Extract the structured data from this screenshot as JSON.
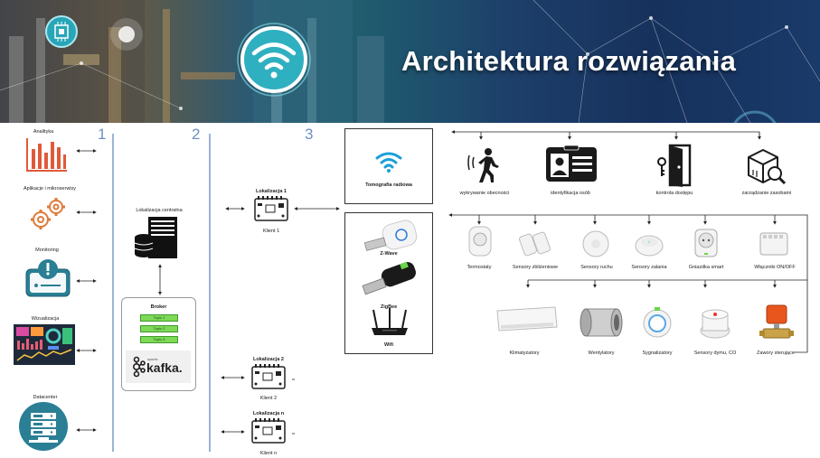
{
  "banner": {
    "title": "Architektura rozwiązania"
  },
  "columns": [
    "1",
    "2",
    "3"
  ],
  "col1": {
    "items": [
      {
        "label": "Analityka",
        "icon": "bar-chart-icon"
      },
      {
        "label": "Aplikacje i mikroserwisy",
        "icon": "gears-icon"
      },
      {
        "label": "Monitoring",
        "icon": "monitoring-alert-icon"
      },
      {
        "label": "Wizualizacja",
        "icon": "dashboard-icon"
      },
      {
        "label": "Datacenter",
        "icon": "datacenter-icon"
      }
    ]
  },
  "col2": {
    "central": {
      "label": "Lokalizacja centralna",
      "icon": "server-icon"
    },
    "broker": {
      "label": "Broker",
      "topics": [
        "Topic 1",
        "Topic 2",
        "Topic 3"
      ],
      "logo_prefix": "apache",
      "logo": "kafka."
    }
  },
  "col3": {
    "locations": [
      {
        "title": "Lokalizacja 1",
        "client": "Klient 1"
      },
      {
        "title": "Lokalizacja 2",
        "client": "Klient 2"
      },
      {
        "title": "Lokalizacja n",
        "client": "Klient n"
      }
    ],
    "tomography": {
      "label": "Tomografia radiowa"
    },
    "radios": [
      {
        "label": "Z-Wave"
      },
      {
        "label": "ZigBee"
      },
      {
        "label": "Wifi"
      }
    ]
  },
  "top_functions": [
    {
      "label": "wykrywanie obecności",
      "icon": "presence-detection-icon"
    },
    {
      "label": "identyfikacja osób",
      "icon": "id-card-icon"
    },
    {
      "label": "kontrola dostępu",
      "icon": "door-access-icon"
    },
    {
      "label": "zarządzanie zasobami",
      "icon": "package-search-icon"
    }
  ],
  "sensors_row": [
    {
      "label": "Termostaty",
      "icon": "thermostat-icon"
    },
    {
      "label": "Sensory zbliżeniowe",
      "icon": "proximity-sensor-icon"
    },
    {
      "label": "Sensory ruchu",
      "icon": "motion-sensor-icon"
    },
    {
      "label": "Sensory zalania",
      "icon": "flood-sensor-icon"
    },
    {
      "label": "Gniazdka smart",
      "icon": "smart-plug-icon"
    },
    {
      "label": "Włączniki ON/OFF",
      "icon": "relay-switch-icon"
    }
  ],
  "actuators_row": [
    {
      "label": "Klimatyzatory",
      "icon": "air-conditioner-icon"
    },
    {
      "label": "Wentylatory",
      "icon": "fan-duct-icon"
    },
    {
      "label": "Sygnalizatory",
      "icon": "siren-icon"
    },
    {
      "label": "Sensory dymu, CO",
      "icon": "smoke-detector-icon"
    },
    {
      "label": "Zawory sterujące",
      "icon": "control-valve-icon"
    }
  ],
  "colors": {
    "accent": "#e05a3a",
    "teal": "#2a7f94",
    "line": "#9ab3d6",
    "topic": "#7ed957",
    "kafka": "#231f20"
  }
}
